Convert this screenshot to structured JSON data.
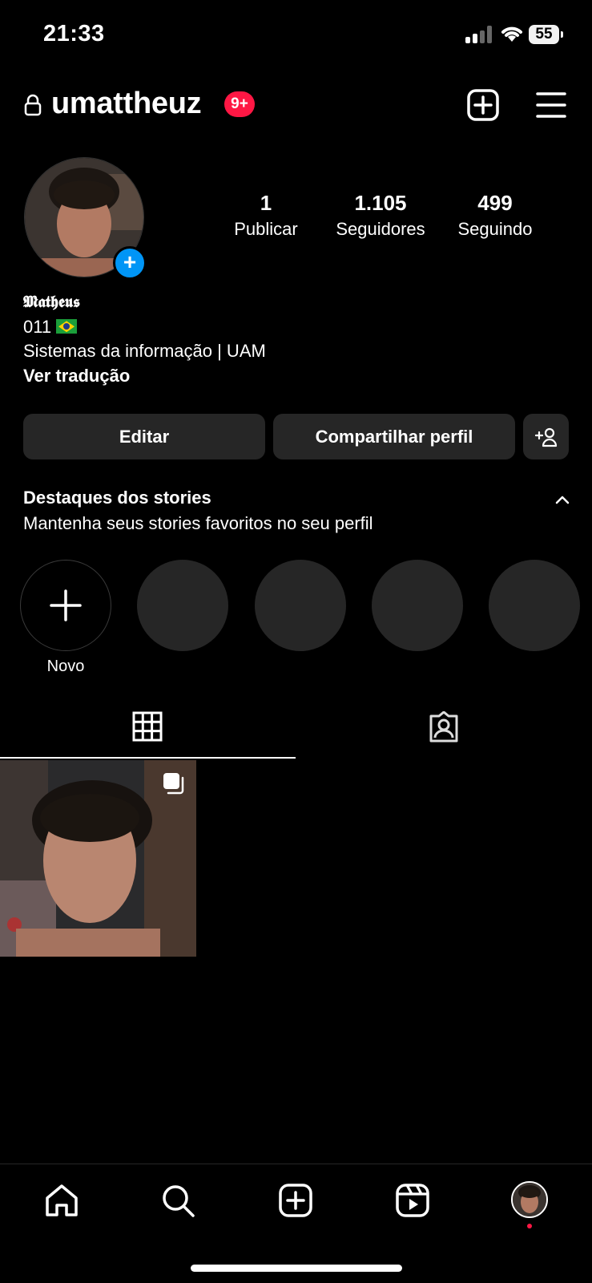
{
  "status_bar": {
    "time": "21:33",
    "battery": "55"
  },
  "header": {
    "username": "umattheuz",
    "notification_badge": "9+"
  },
  "profile": {
    "stats": [
      {
        "value": "1",
        "label": "Publicar"
      },
      {
        "value": "1.105",
        "label": "Seguidores"
      },
      {
        "value": "499",
        "label": "Seguindo"
      }
    ],
    "display_name": "𝕸𝖆𝖙𝖍𝖊𝖚𝖘",
    "bio_line1": "011",
    "bio_line2": "Sistemas da informação | UAM",
    "translate_link": "Ver tradução"
  },
  "actions": {
    "edit": "Editar",
    "share": "Compartilhar perfil"
  },
  "highlights": {
    "title": "Destaques dos stories",
    "subtitle": "Mantenha seus stories favoritos no seu perfil",
    "new_label": "Novo"
  },
  "icons": [
    "lock-icon",
    "add-post-icon",
    "menu-icon",
    "add-user-icon",
    "chevron-up-icon",
    "grid-icon",
    "tagged-icon",
    "multiple-photos-icon",
    "home-icon",
    "search-icon",
    "create-icon",
    "reels-icon"
  ],
  "colors": {
    "accent_blue": "#0095f6",
    "badge_red": "#ff1744",
    "button_bg": "#262626"
  }
}
